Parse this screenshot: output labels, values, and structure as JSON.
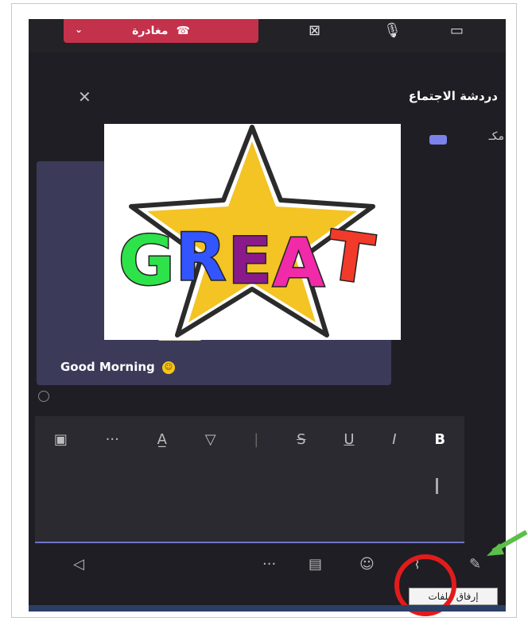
{
  "top_bar": {
    "leave_label": "مغادرة",
    "leave_chevron": "⌄"
  },
  "chat_panel": {
    "title": "دردشة الاجتماع",
    "close_symbol": "✕",
    "meeting_label": "مكـ"
  },
  "message": {
    "text": "Good Morning",
    "emoji": "smiley-emoji"
  },
  "sticker": {
    "text": "GREAT",
    "letters": [
      {
        "char": "G",
        "color": "#2ee24a"
      },
      {
        "char": "R",
        "color": "#3355ff"
      },
      {
        "char": "E",
        "color": "#8a1a8a"
      },
      {
        "char": "A",
        "color": "#f02aa8"
      },
      {
        "char": "T",
        "color": "#f23a2a"
      }
    ],
    "star_color": "#f4c324"
  },
  "format_toolbar": {
    "items": [
      "clipboard-icon",
      "more-icon",
      "font-color-icon",
      "highlight-icon",
      "strikethrough-icon",
      "underline-icon",
      "italic-icon",
      "bold-icon"
    ],
    "more_label": "···",
    "underline_label": "U",
    "italic_label": "I",
    "bold_label": "B",
    "strike_label": "S"
  },
  "actions": {
    "more_label": "···"
  },
  "tooltip": {
    "text": "إرفاق ملفات"
  },
  "colors": {
    "app_bg": "#1f1e24",
    "message_card": "#3b3a59",
    "accent": "#6f74c9",
    "leave_red": "#c4314b",
    "highlight_circle": "#e21b1b",
    "arrow_green": "#5bbf4a"
  }
}
